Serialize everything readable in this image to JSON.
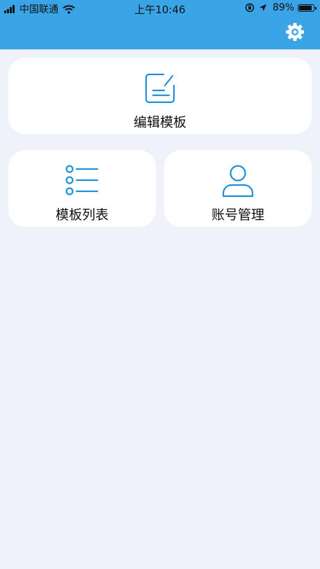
{
  "status_bar": {
    "carrier": "中国联通",
    "time": "上午10:46",
    "battery": "89%",
    "battery_level": 0.89
  },
  "header": {
    "settings_icon": "gear-icon",
    "accent_color": "#3aa4e6"
  },
  "cards": {
    "edit_template": {
      "label": "编辑模板",
      "icon": "edit-note-icon"
    },
    "template_list": {
      "label": "模板列表",
      "icon": "list-icon"
    },
    "account_manage": {
      "label": "账号管理",
      "icon": "user-icon"
    }
  }
}
